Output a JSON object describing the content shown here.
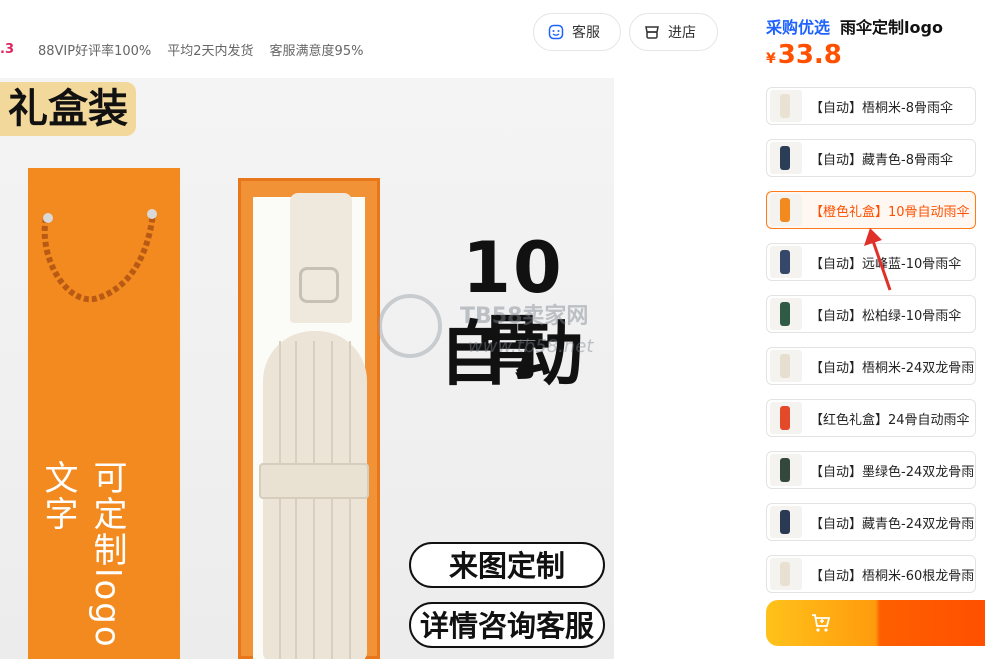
{
  "store": {
    "score_fragment": ".3",
    "stats": [
      "88VIP好评率100%",
      "平均2天内发货",
      "客服满意度95%"
    ]
  },
  "header_buttons": {
    "service": "客服",
    "store": "进店"
  },
  "product_image": {
    "gift_tag": "礼盒装",
    "bag_text": "可定制logo文字",
    "headline_1": "10骨",
    "headline_2": "自动",
    "chip_1": "来图定制",
    "chip_2": "详情咨询客服",
    "watermark_title": "TB58卖家网",
    "watermark_url": "www.tb58.net"
  },
  "right_panel": {
    "brand": "采购优选",
    "title": "雨伞定制logo",
    "currency": "¥",
    "price": "33.8"
  },
  "skus": [
    {
      "label": "【自动】梧桐米-8骨雨伞",
      "color": "#e9e2d2"
    },
    {
      "label": "【自动】藏青色-8骨雨伞",
      "color": "#2c3e57"
    },
    {
      "label": "【橙色礼盒】10骨自动雨伞",
      "color": "#f28a1f",
      "selected": true
    },
    {
      "label": "【自动】远峰蓝-10骨雨伞",
      "color": "#35486a"
    },
    {
      "label": "【自动】松柏绿-10骨雨伞",
      "color": "#2f5a43"
    },
    {
      "label": "【自动】梧桐米-24双龙骨雨",
      "color": "#e6dfcf"
    },
    {
      "label": "【红色礼盒】24骨自动雨伞",
      "color": "#e34a2a"
    },
    {
      "label": "【自动】墨绿色-24双龙骨雨",
      "color": "#34473c"
    },
    {
      "label": "【自动】藏青色-24双龙骨雨",
      "color": "#2a3a55"
    },
    {
      "label": "【自动】梧桐米-60根龙骨雨",
      "color": "#e8e1d1"
    }
  ],
  "colors": {
    "accent": "#ff5000",
    "brand_blue": "#1e63ff",
    "bag_orange": "#f28a1f"
  }
}
